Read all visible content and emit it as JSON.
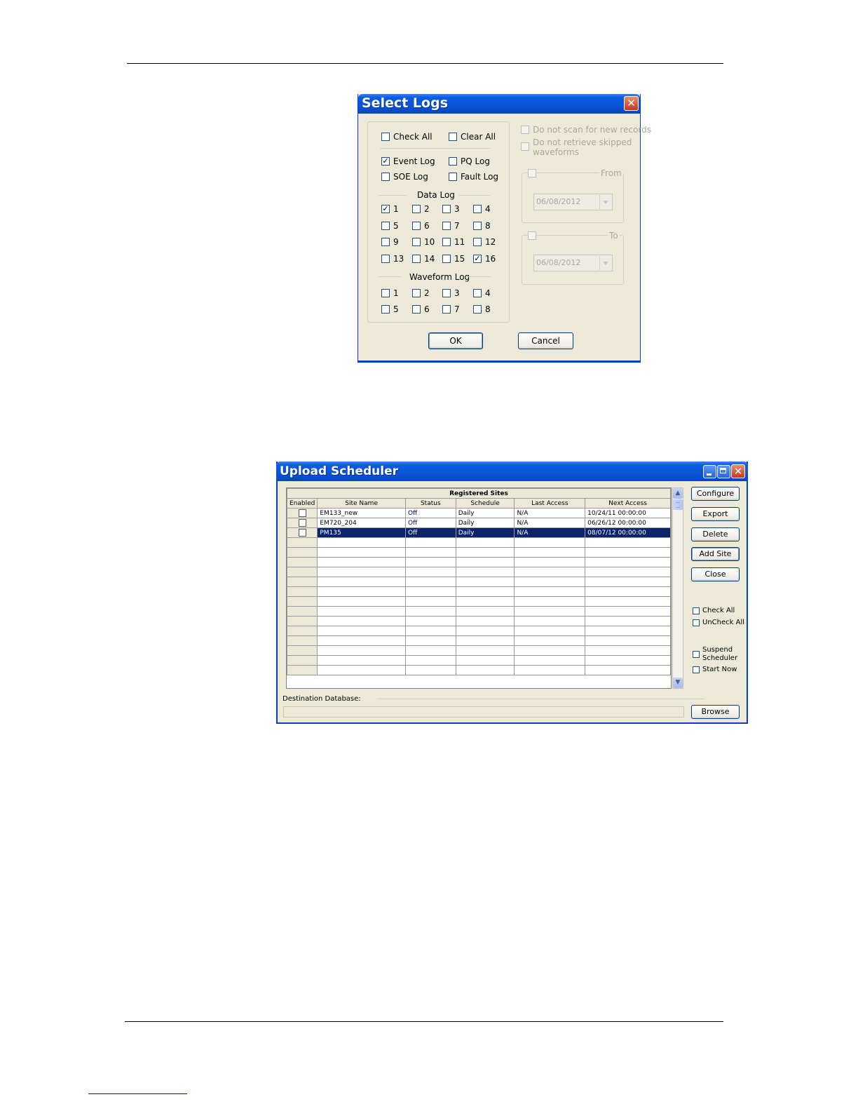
{
  "select_logs": {
    "title": "Select Logs",
    "check_all": "Check All",
    "clear_all": "Clear All",
    "event_log": "Event Log",
    "pq_log": "PQ Log",
    "soe_log": "SOE Log",
    "fault_log": "Fault Log",
    "data_log_title": "Data Log",
    "data_log_labels": [
      "1",
      "2",
      "3",
      "4",
      "5",
      "6",
      "7",
      "8",
      "9",
      "10",
      "11",
      "12",
      "13",
      "14",
      "15",
      "16"
    ],
    "data_log_checked": [
      true,
      false,
      false,
      false,
      false,
      false,
      false,
      false,
      false,
      false,
      false,
      false,
      false,
      false,
      false,
      true
    ],
    "event_log_checked": true,
    "waveform_log_title": "Waveform Log",
    "waveform_log_labels": [
      "1",
      "2",
      "3",
      "4",
      "5",
      "6",
      "7",
      "8"
    ],
    "no_scan": "Do not scan for new records",
    "no_retrieve_1": "Do not retrieve skipped",
    "no_retrieve_2": "waveforms",
    "from_label": "From",
    "from_date": "06/08/2012",
    "to_label": "To",
    "to_date": "06/08/2012",
    "ok": "OK",
    "cancel": "Cancel"
  },
  "upload_scheduler": {
    "title": "Upload Scheduler",
    "grid_caption": "Registered Sites",
    "columns": [
      "Enabled",
      "Site Name",
      "Status",
      "Schedule",
      "Last Access",
      "Next Access"
    ],
    "rows": [
      {
        "site": "EM133_new",
        "status": "Off",
        "schedule": "Daily",
        "last": "N/A",
        "next": "10/24/11 00:00:00"
      },
      {
        "site": "EM720_204",
        "status": "Off",
        "schedule": "Daily",
        "last": "N/A",
        "next": "06/26/12 00:00:00"
      },
      {
        "site": "PM135",
        "status": "Off",
        "schedule": "Daily",
        "last": "N/A",
        "next": "08/07/12 00:00:00",
        "selected": true
      }
    ],
    "buttons": {
      "configure": "Configure",
      "export": "Export",
      "delete": "Delete",
      "add_site": "Add Site",
      "close": "Close",
      "browse": "Browse"
    },
    "check_all": "Check All",
    "uncheck_all": "UnCheck All",
    "suspend_1": "Suspend",
    "suspend_2": "Scheduler",
    "start_now": "Start Now",
    "dest_db_label": "Destination Database:"
  }
}
